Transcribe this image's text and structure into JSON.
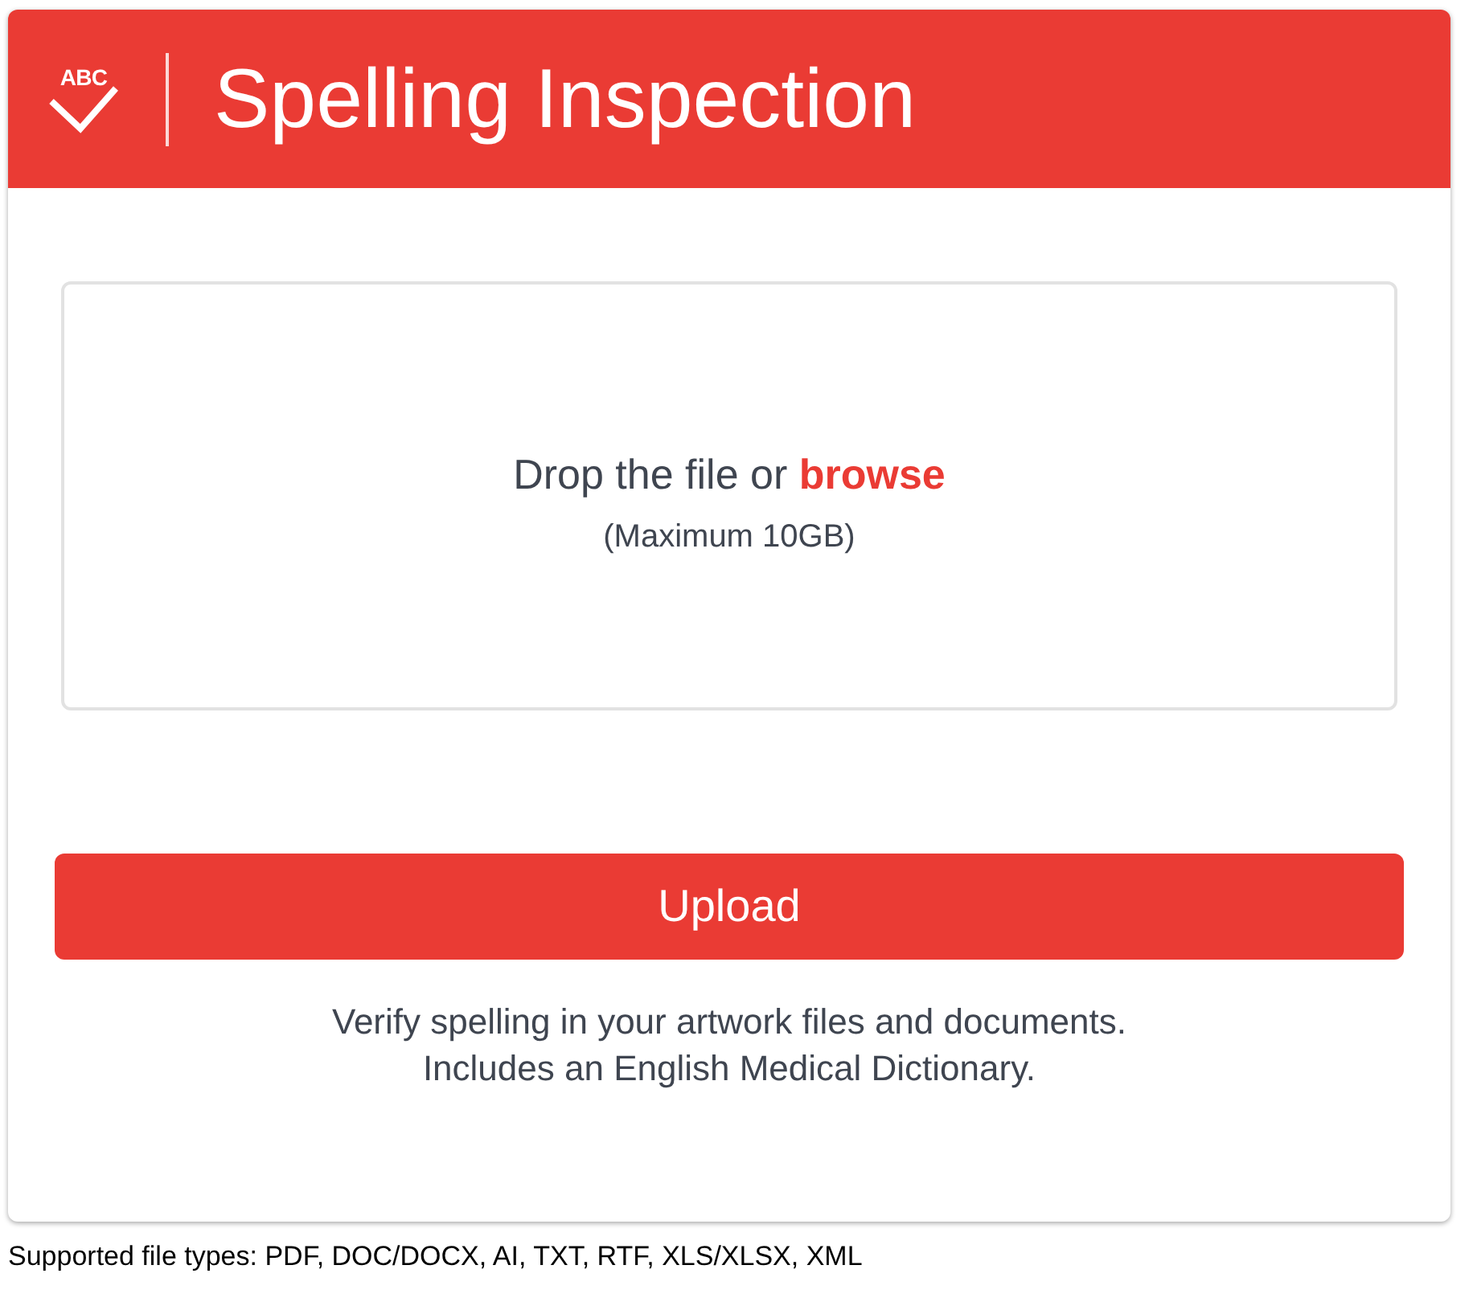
{
  "header": {
    "logo_text": "ABC",
    "title": "Spelling Inspection"
  },
  "dropzone": {
    "text": "Drop the file or",
    "link": "browse",
    "hint": "(Maximum 10GB)"
  },
  "upload_button": "Upload",
  "description": [
    "Verify spelling in your artwork files and documents.",
    "Includes an English Medical Dictionary."
  ],
  "footer": "Supported file types: PDF, DOC/DOCX, AI, TXT, RTF, XLS/XLSX, XML"
}
